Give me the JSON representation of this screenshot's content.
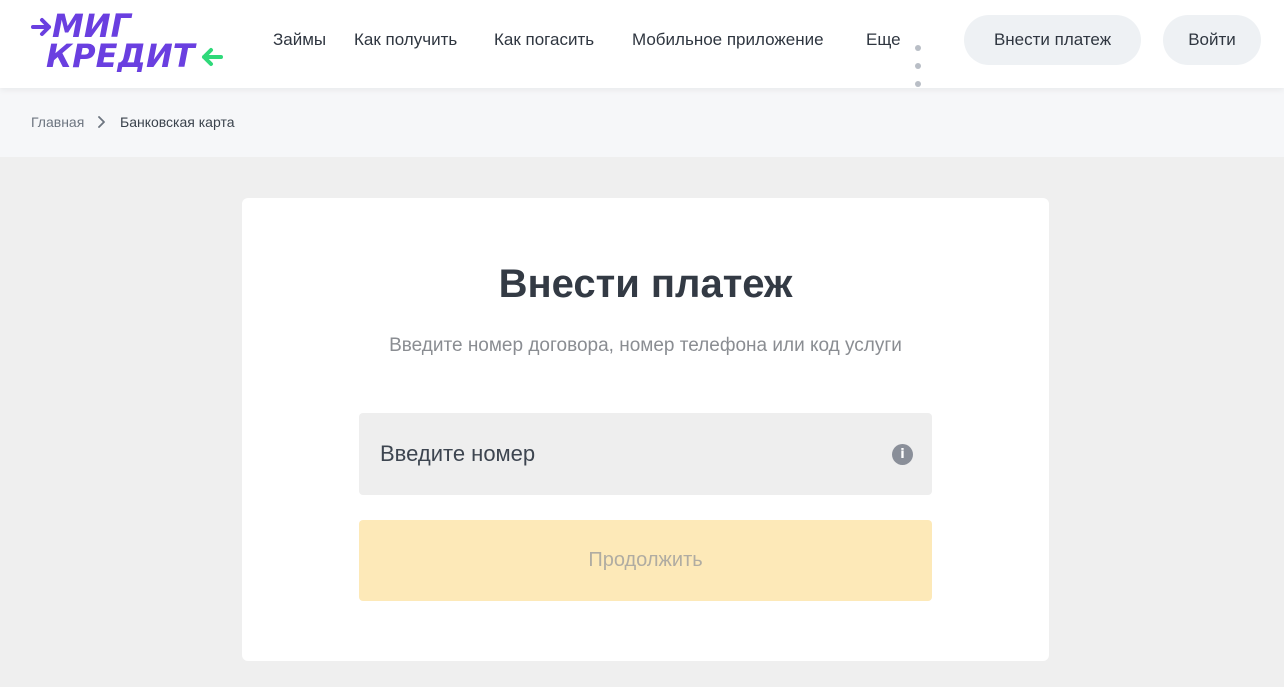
{
  "brand": {
    "line1": "МИГ",
    "line2": "КРЕДИТ",
    "color_primary": "#6a3fe0",
    "color_accent": "#2fd97a"
  },
  "nav": {
    "items": [
      {
        "label": "Займы"
      },
      {
        "label": "Как получить"
      },
      {
        "label": "Как погасить"
      },
      {
        "label": "Мобильное приложение"
      },
      {
        "label": "Еще"
      }
    ],
    "more_icon": "more-dots-icon"
  },
  "header": {
    "pay_button": "Внести платеж",
    "login_button": "Войти"
  },
  "breadcrumbs": {
    "home": "Главная",
    "separator_icon": "chevron-right-icon",
    "current": "Банковская карта"
  },
  "payment_form": {
    "title": "Внести платеж",
    "subtitle": "Введите номер договора, номер телефона или код услуги",
    "input_placeholder": "Введите номер",
    "input_value": "",
    "info_icon": "info-icon",
    "info_glyph": "i",
    "continue_button": "Продолжить",
    "continue_disabled": true
  }
}
